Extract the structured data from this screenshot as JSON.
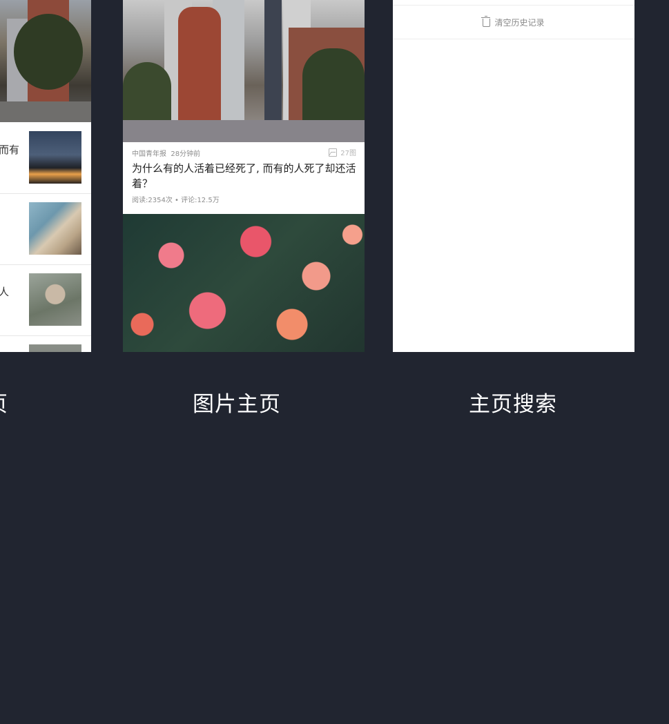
{
  "captions": {
    "left": "页",
    "middle": "图片主页",
    "right": "主页搜索"
  },
  "left_screen": {
    "rows": [
      {
        "text": "而有",
        "thumb": "campfire-photo"
      },
      {
        "text": "",
        "thumb": "dogs-in-car-photo"
      },
      {
        "text": "人",
        "thumb": "woman-portrait-photo"
      },
      {
        "text": "",
        "thumb": "partial-photo"
      }
    ]
  },
  "middle_screen": {
    "source": "中国青年报",
    "time": "28分钟前",
    "image_count": "27图",
    "headline": "为什么有的人活着已经死了, 而有的人死了却还活着？",
    "stats": "阅读:2354次 • 评论:12.5万"
  },
  "right_screen": {
    "clear_history_label": "清空历史记录"
  }
}
